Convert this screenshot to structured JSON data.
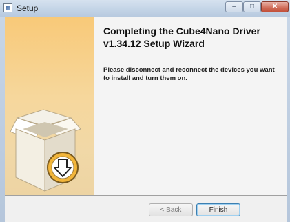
{
  "window": {
    "title": "Setup",
    "controls": {
      "minimize": "–",
      "maximize": "□",
      "close": "✕"
    }
  },
  "wizard": {
    "heading": "Completing the Cube4Nano Driver v1.34.12 Setup Wizard",
    "description": "Please disconnect and reconnect the devices you want to install and turn them on."
  },
  "footer": {
    "back_label": "< Back",
    "finish_label": "Finish"
  },
  "icons": {
    "app": "setup-app-icon",
    "side_art": "open-box-download-icon"
  },
  "colors": {
    "side_panel": "#f8c978",
    "arrow_badge": "#f2b53a"
  }
}
